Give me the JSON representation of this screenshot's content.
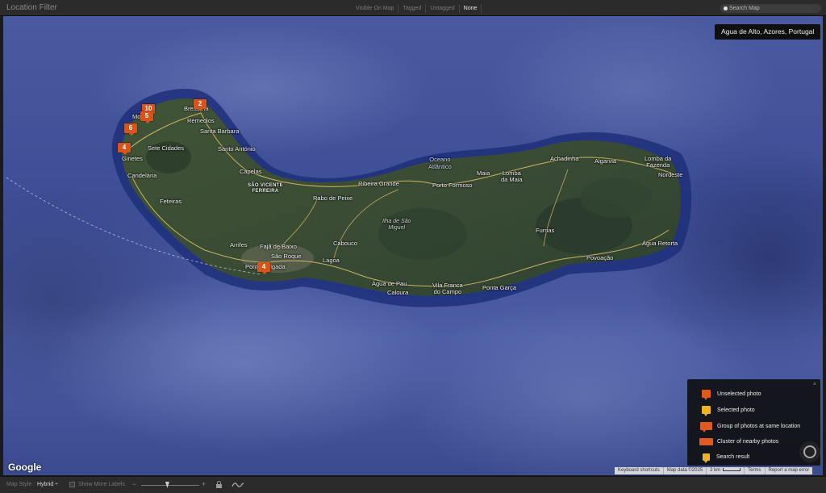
{
  "filter_bar": {
    "title": "Location Filter",
    "tabs": [
      {
        "label": "Visible On Map",
        "active": false
      },
      {
        "label": "Tagged",
        "active": false
      },
      {
        "label": "Untagged",
        "active": false
      },
      {
        "label": "None",
        "active": true
      }
    ],
    "search_placeholder": "Search Map"
  },
  "map": {
    "location_badge": "Agua de Alto, Azores, Portugal",
    "places": {
      "bretanha": "Bretanha",
      "remedios": "Remedios",
      "santa_barbara": "Santa Barbara",
      "santo_antonio": "Santo António",
      "mosteiros": "Mo",
      "sete_cidades": "Sete Cidades",
      "ginetes": "Ginetes",
      "candelaria": "Candelária",
      "feteiras": "Feteiras",
      "capelas": "Capelas",
      "sao_vicente": "SÃO VICENTE\nFERREIRA",
      "rabo_de_peixe": "Rabo de Peixe",
      "ribeira_grande": "Ribeira Grande",
      "oceano": "Oceano\nAtlântico",
      "porto_formoso": "Porto Formoso",
      "maia": "Maia",
      "lomba_da_maia": "Lomba\nda Maia",
      "achadinha": "Achadinha",
      "algarvia": "Algarvia",
      "lomba_da_fazenda": "Lomba da\nFazenda",
      "nordeste": "Nordeste",
      "ilha": "Ilha de São\nMiguel",
      "arrifes": "Arrifes",
      "faja_de_baixo": "Fajã de Baixo",
      "sao_roque": "São Roque",
      "cabouco": "Cabouco",
      "lagoa": "Lagoa",
      "ponta_delgada": "Ponta Delgada",
      "furnas": "Furnas",
      "agua_retorta": "Água Retorta",
      "povoacao": "Povoação",
      "agua_de_pau": "Água de Pau",
      "caloura": "Caloura",
      "vila_franca": "Vila Franca\ndo Campo",
      "ponta_garca": "Ponta Garça"
    },
    "markers": {
      "m1": "10",
      "m2": "2",
      "m3": "5",
      "m4": "6",
      "m5": "4",
      "m6": "4"
    },
    "legend": {
      "close": "×",
      "items": [
        {
          "label": "Unselected photo"
        },
        {
          "label": "Selected photo"
        },
        {
          "label": "Group of photos at same location"
        },
        {
          "label": "Cluster of nearby photos"
        },
        {
          "label": "Search result"
        }
      ]
    },
    "google_logo": "Google",
    "attribution": {
      "shortcuts": "Keyboard shortcuts",
      "map_data": "Map data ©2025",
      "scale": "2 km",
      "terms": "Terms",
      "report": "Report a map error"
    }
  },
  "bottom_bar": {
    "map_style_label": "Map Style :",
    "map_style_value": "Hybrid ÷",
    "show_more_labels": "Show More Labels",
    "zoom_minus": "−",
    "zoom_plus": "+",
    "zoom_level": 0.45
  },
  "colors": {
    "marker": "#d9541a",
    "selected": "#f0b323",
    "ocean": "#4252a0",
    "land": "#3c4e35"
  }
}
